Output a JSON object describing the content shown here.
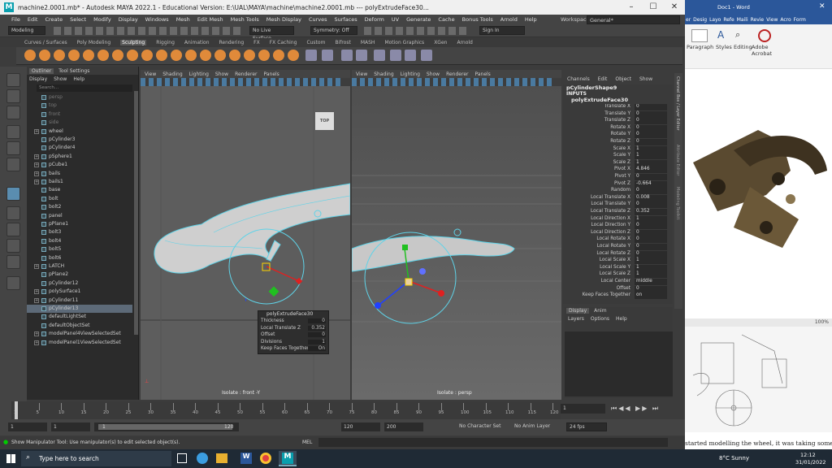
{
  "title": "machine2.0001.mb* - Autodesk MAYA 2022.1 - Educational Version: E:\\UAL\\MAYA\\machine\\machine2.0001.mb  ---  polyExtrudeFace30...",
  "window_controls": [
    "–",
    "☐",
    "✕"
  ],
  "menu": [
    "File",
    "Edit",
    "Create",
    "Select",
    "Modify",
    "Display",
    "Windows",
    "Mesh",
    "Edit Mesh",
    "Mesh Tools",
    "Mesh Display",
    "Curves",
    "Surfaces",
    "Deform",
    "UV",
    "Generate",
    "Cache",
    "Bonus Tools",
    "Arnold",
    "Help"
  ],
  "workspace": {
    "label": "Workspace:",
    "value": "General*"
  },
  "status": {
    "mode": "Modeling",
    "live": "No Live Surface",
    "symmetry": "Symmetry: Off",
    "signin": "Sign In"
  },
  "shelf_tabs": [
    "Curves / Surfaces",
    "Poly Modeling",
    "Sculpting",
    "Rigging",
    "Animation",
    "Rendering",
    "FX",
    "FX Caching",
    "Custom",
    "Bifrost",
    "MASH",
    "Motion Graphics",
    "XGen",
    "Arnold"
  ],
  "shelf_active": "Sculpting",
  "outliner": {
    "tabs": [
      "Outliner",
      "Tool Settings"
    ],
    "menu": [
      "Display",
      "Show",
      "Help"
    ],
    "search": "Search...",
    "items": [
      {
        "name": "persp",
        "dim": true
      },
      {
        "name": "top",
        "dim": true
      },
      {
        "name": "front",
        "dim": true
      },
      {
        "name": "side",
        "dim": true
      },
      {
        "name": "wheel",
        "plus": true
      },
      {
        "name": "pCylinder3"
      },
      {
        "name": "pCylinder4"
      },
      {
        "name": "pSphere1",
        "plus": true
      },
      {
        "name": "pCube1",
        "plus": true
      },
      {
        "name": "bails",
        "plus": true
      },
      {
        "name": "bails1",
        "plus": true
      },
      {
        "name": "base"
      },
      {
        "name": "bolt"
      },
      {
        "name": "bolt2"
      },
      {
        "name": "panel"
      },
      {
        "name": "pPlane1"
      },
      {
        "name": "bolt3"
      },
      {
        "name": "bolt4"
      },
      {
        "name": "bolt5"
      },
      {
        "name": "bolt6"
      },
      {
        "name": "LATCH",
        "plus": true
      },
      {
        "name": "pPlane2"
      },
      {
        "name": "pCylinder12"
      },
      {
        "name": "polySurface1",
        "plus": true
      },
      {
        "name": "pCylinder11",
        "plus": true
      },
      {
        "name": "pCylinder13",
        "selected": true
      },
      {
        "name": "defaultLightSet"
      },
      {
        "name": "defaultObjectSet"
      },
      {
        "name": "modelPanel4ViewSelectedSet",
        "plus": true
      },
      {
        "name": "modelPanel1ViewSelectedSet",
        "plus": true
      }
    ]
  },
  "viewport_menu": [
    "View",
    "Shading",
    "Lighting",
    "Show",
    "Renderer",
    "Panels"
  ],
  "viewport_left": {
    "label": "Isolate : front -Y",
    "cube": "TOP"
  },
  "viewport_right": {
    "label": "Isolate : persp"
  },
  "hud": {
    "title": "polyExtrudeFace30",
    "rows": [
      {
        "k": "Thickness",
        "v": "0"
      },
      {
        "k": "Local Translate Z",
        "v": "0.352"
      },
      {
        "k": "Offset",
        "v": "0"
      },
      {
        "k": "Divisions",
        "v": "1"
      },
      {
        "k": "Keep Faces Together",
        "v": "On"
      }
    ]
  },
  "channel_box": {
    "menu": [
      "Channels",
      "Edit",
      "Object",
      "Show"
    ],
    "object": "pCylinderShape9",
    "inputs": "INPUTS",
    "node": "polyExtrudeFace30",
    "attrs": [
      {
        "k": "Translate X",
        "v": "0"
      },
      {
        "k": "Translate Y",
        "v": "0"
      },
      {
        "k": "Translate Z",
        "v": "0"
      },
      {
        "k": "Rotate X",
        "v": "0"
      },
      {
        "k": "Rotate Y",
        "v": "0"
      },
      {
        "k": "Rotate Z",
        "v": "0"
      },
      {
        "k": "Scale X",
        "v": "1"
      },
      {
        "k": "Scale Y",
        "v": "1"
      },
      {
        "k": "Scale Z",
        "v": "1"
      },
      {
        "k": "Pivot X",
        "v": "4.846"
      },
      {
        "k": "Pivot Y",
        "v": "0"
      },
      {
        "k": "Pivot Z",
        "v": "-0.664"
      },
      {
        "k": "Random",
        "v": "0"
      },
      {
        "k": "Local Translate X",
        "v": "0.008"
      },
      {
        "k": "Local Translate Y",
        "v": "0"
      },
      {
        "k": "Local Translate Z",
        "v": "0.352"
      },
      {
        "k": "Local Direction X",
        "v": "1"
      },
      {
        "k": "Local Direction Y",
        "v": "0"
      },
      {
        "k": "Local Direction Z",
        "v": "0"
      },
      {
        "k": "Local Rotate X",
        "v": "0"
      },
      {
        "k": "Local Rotate Y",
        "v": "0"
      },
      {
        "k": "Local Rotate Z",
        "v": "0"
      },
      {
        "k": "Local Scale X",
        "v": "1"
      },
      {
        "k": "Local Scale Y",
        "v": "1"
      },
      {
        "k": "Local Scale Z",
        "v": "1"
      },
      {
        "k": "Local Center",
        "v": "middle"
      },
      {
        "k": "Offset",
        "v": "0"
      },
      {
        "k": "Keep Faces Together",
        "v": "on"
      }
    ],
    "side_tabs": [
      "Channel Box / Layer Editor",
      "Attribute Editor",
      "Modeling Toolkit"
    ]
  },
  "layer_editor": {
    "tabs": [
      "Display",
      "Anim"
    ],
    "menu": [
      "Layers",
      "Options",
      "Help"
    ]
  },
  "timeline": {
    "ticks": [
      "1",
      "5",
      "10",
      "15",
      "20",
      "25",
      "30",
      "35",
      "40",
      "45",
      "50",
      "55",
      "60",
      "65",
      "70",
      "75",
      "80",
      "85",
      "90",
      "95",
      "100",
      "105",
      "110",
      "115",
      "120"
    ],
    "current": "1"
  },
  "range": {
    "start": "1",
    "start2": "1",
    "frame": "1",
    "end_inner": "120",
    "end": "120",
    "end2": "200",
    "character": "No Character Set",
    "anim_layer": "No Anim Layer",
    "fps": "24 fps"
  },
  "cmdline": {
    "lang": "MEL",
    "help": "Show Manipulator Tool: Use manipulator(s) to edit selected object(s)."
  },
  "word": {
    "title": "Doc1 - Word",
    "tabs": [
      "er",
      "Desig",
      "Layo",
      "Refe",
      "Maili",
      "Revie",
      "View",
      "Acro",
      "Form"
    ],
    "groups": [
      "Paragraph",
      "Styles",
      "Editing",
      "Adobe Acrobat"
    ],
    "zoom": "100%",
    "text": "started modelling the wheel, it was taking some ti"
  },
  "taskbar": {
    "search": "Type here to search",
    "weather": "8°C  Sunny",
    "time": "12:12",
    "date": "31/01/2022"
  },
  "colors": {
    "maya_bg": "#444444",
    "viewport": "#5d5d5d",
    "accent": "#0a9fae",
    "wire": "#5fd3e8"
  }
}
